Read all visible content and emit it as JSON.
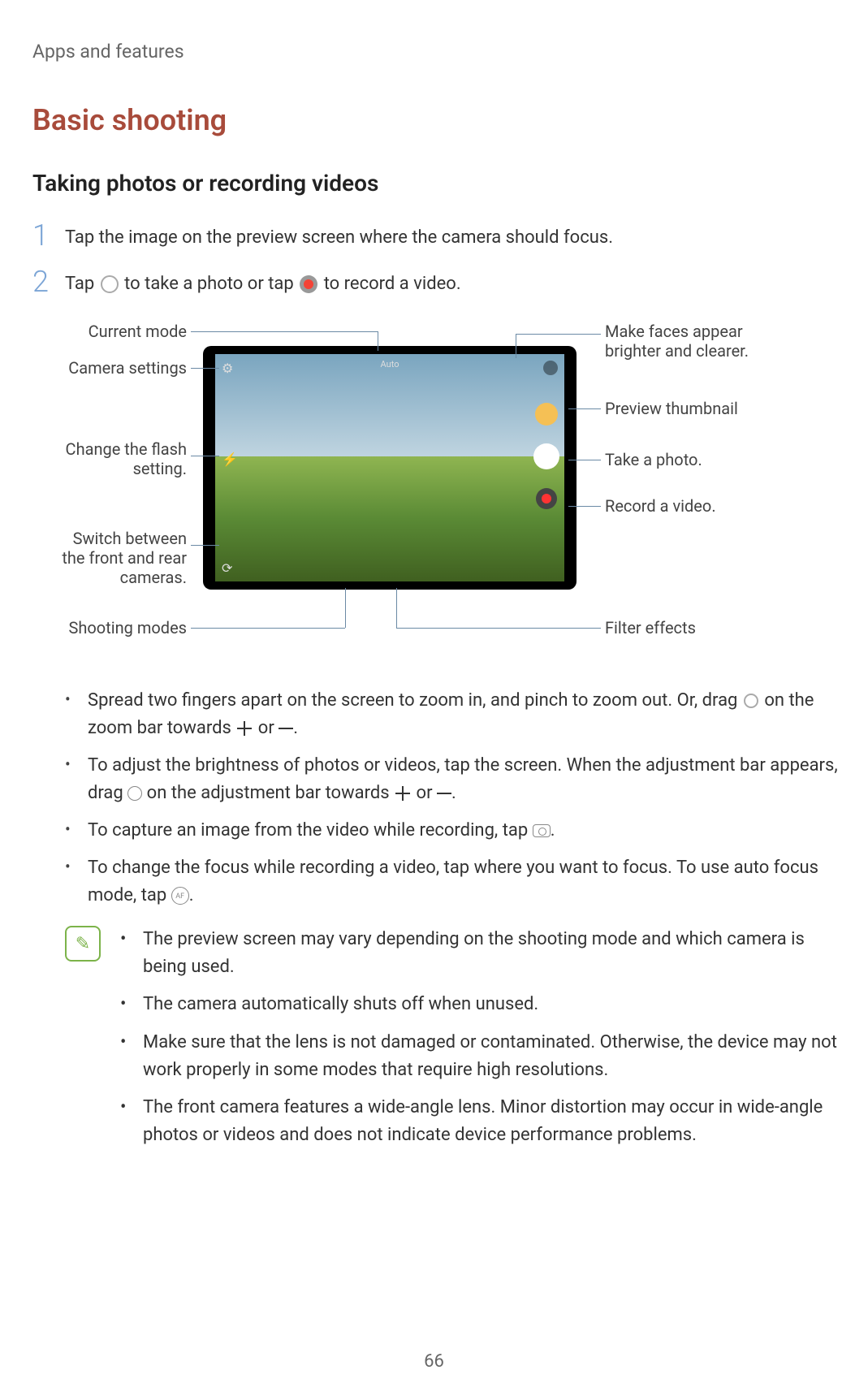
{
  "header": "Apps and features",
  "section_title": "Basic shooting",
  "subsection_title": "Taking photos or recording videos",
  "steps": [
    {
      "num": "1",
      "text": "Tap the image on the preview screen where the camera should focus."
    },
    {
      "num": "2",
      "text_before": "Tap ",
      "text_mid": " to take a photo or tap ",
      "text_after": " to record a video."
    }
  ],
  "diagram": {
    "mode_label": "Auto",
    "callouts": {
      "current_mode": "Current mode",
      "camera_settings": "Camera settings",
      "change_flash": "Change the flash setting.",
      "switch_cameras": "Switch between the front and rear cameras.",
      "shooting_modes": "Shooting modes",
      "make_faces": "Make faces appear brighter and clearer.",
      "preview_thumb": "Preview thumbnail",
      "take_photo": "Take a photo.",
      "record_video": "Record a video.",
      "filter_effects": "Filter effects"
    }
  },
  "bullets": [
    "Spread two fingers apart on the screen to zoom in, and pinch to zoom out. Or, drag ◯ on the zoom bar towards ＋ or —.",
    "To adjust the brightness of photos or videos, tap the screen. When the adjustment bar appears, drag ☀ on the adjustment bar towards ＋ or —.",
    "To capture an image from the video while recording, tap 📷.",
    "To change the focus while recording a video, tap where you want to focus. To use auto focus mode, tap ㉳."
  ],
  "note_bullets": [
    "The preview screen may vary depending on the shooting mode and which camera is being used.",
    "The camera automatically shuts off when unused.",
    "Make sure that the lens is not damaged or contaminated. Otherwise, the device may not work properly in some modes that require high resolutions.",
    "The front camera features a wide-angle lens. Minor distortion may occur in wide-angle photos or videos and does not indicate device performance problems."
  ],
  "af_label": "AF",
  "page_number": "66"
}
